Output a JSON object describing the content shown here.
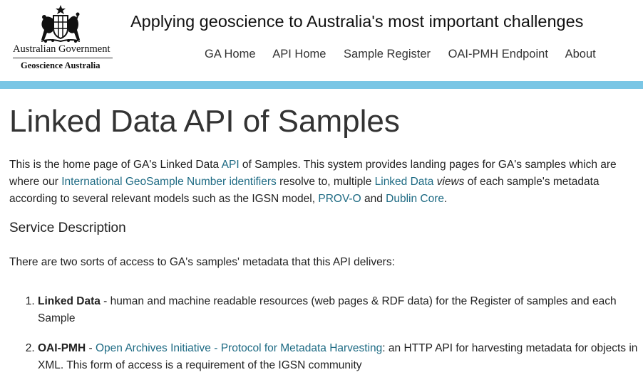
{
  "header": {
    "gov_name": "Australian Government",
    "agency_name": "Geoscience Australia",
    "tagline": "Applying geoscience to Australia's most important challenges",
    "nav": [
      "GA Home",
      "API Home",
      "Sample Register",
      "OAI-PMH Endpoint",
      "About"
    ]
  },
  "main": {
    "title": "Linked Data API of Samples",
    "intro": {
      "t1": "This is the home page of GA's Linked Data ",
      "api_link": "API",
      "t2": " of Samples. This system provides landing pages for GA's samples which are where our ",
      "igsn_link": "International GeoSample Number identifiers",
      "t3": " resolve to, multiple ",
      "ld_link": "Linked Data",
      "views": "views",
      "t4": " of each sample's metadata according to several relevant models such as the IGSN model, ",
      "provo_link": "PROV-O",
      "t5": " and ",
      "dc_link": "Dublin Core",
      "t6": "."
    },
    "service_heading": "Service Description",
    "access_text": "There are two sorts of access to GA's samples' metadata that this API delivers:",
    "list": {
      "item1_bold": "Linked Data",
      "item1_text": " - human and machine readable resources (web pages & RDF data) for the Register of samples and each Sample",
      "item2_bold": "OAI-PMH",
      "item2_sep": " - ",
      "item2_link": "Open Archives Initiative - Protocol for Metadata Harvesting",
      "item2_text": ": an HTTP API for harvesting metadata for objects in XML. This form of access is a requirement of the IGSN community"
    }
  },
  "colors": {
    "band": "#7ac6e5",
    "link": "#1d6a83",
    "text": "#222222"
  }
}
